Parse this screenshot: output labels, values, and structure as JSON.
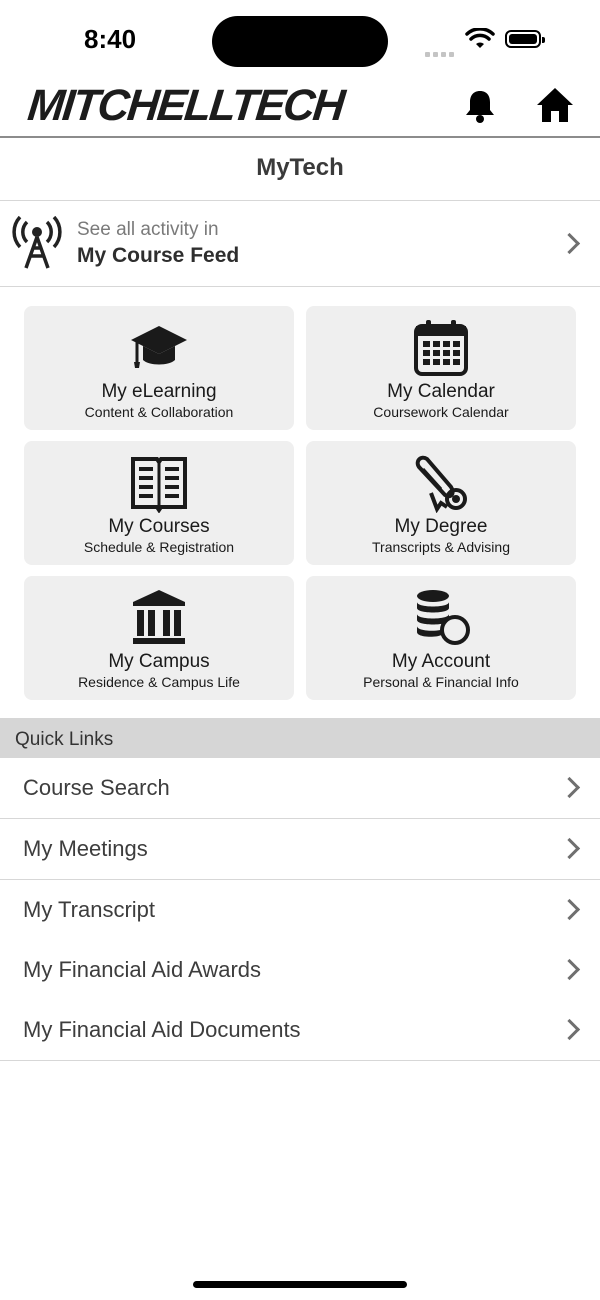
{
  "status": {
    "time": "8:40"
  },
  "header": {
    "logo": "MITCHELLTECH"
  },
  "page": {
    "title": "MyTech"
  },
  "feed": {
    "line1": "See all activity in",
    "line2": "My Course Feed"
  },
  "tiles": [
    {
      "title": "My eLearning",
      "subtitle": "Content & Collaboration",
      "icon": "graduation-cap-icon"
    },
    {
      "title": "My Calendar",
      "subtitle": "Coursework Calendar",
      "icon": "calendar-icon"
    },
    {
      "title": "My Courses",
      "subtitle": "Schedule & Registration",
      "icon": "book-icon"
    },
    {
      "title": "My Degree",
      "subtitle": "Transcripts & Advising",
      "icon": "diploma-icon"
    },
    {
      "title": "My Campus",
      "subtitle": "Residence & Campus Life",
      "icon": "campus-building-icon"
    },
    {
      "title": "My Account",
      "subtitle": "Personal & Financial Info",
      "icon": "coins-icon"
    }
  ],
  "quick_links": {
    "header": "Quick Links",
    "items": [
      {
        "label": "Course Search"
      },
      {
        "label": "My Meetings"
      },
      {
        "label": "My Transcript"
      },
      {
        "label": "My Financial Aid Awards"
      },
      {
        "label": "My Financial Aid Documents"
      }
    ]
  }
}
